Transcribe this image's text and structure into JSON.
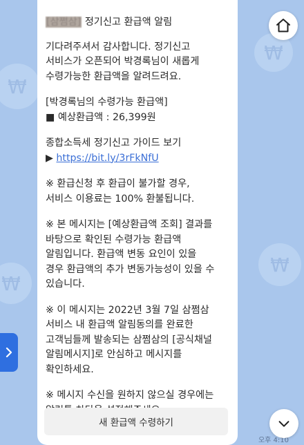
{
  "message": {
    "title_sender": "[삼쩜삼]",
    "title_text": " 정기신고 환급액 알림",
    "greeting_lines": [
      "기다려주셔서 감사합니다. 정기신고",
      "서비스가 오픈되어 박경록님이 새롭게",
      "수령가능한 환급액을 알려드려요."
    ],
    "refund_heading": "[박경록님의 수령가능 환급액]",
    "refund_line": "■ 예상환급액 : 26,399원",
    "guide_title": "종합소득세 정기신고 가이드 보기",
    "guide_arrow": "▶ ",
    "guide_link": "https://bit.ly/3rFkNfU",
    "notice1_lines": [
      "※ 환급신청 후 환급이 불가할 경우,",
      "서비스 이용료는 100% 환불됩니다."
    ],
    "notice2_lines": [
      "※ 본 메시지는 [예상환급액 조회] 결과를",
      "바탕으로 확인된 수령가능 환급액",
      "알림입니다. 환급액 변동 요인이 있을",
      "경우 환급액의 추가 변동가능성이 있을 수",
      "있습니다."
    ],
    "notice3_lines": [
      "※ 이 메시지는 2022년 3월 7일 삼쩜삼",
      "서비스 내 환급액 알림동의를 완료한",
      "고객님들께 발송되는 삼쩜삼의 [공식채널",
      "알림메시지]로 안심하고 메시지를",
      "확인하세요."
    ],
    "notice4_lines": [
      "※ 메시지 수신을 원하지 않으실 경우에는",
      "알림톡 차단을 설정해주세요."
    ],
    "button_label": "새 환급액 수령하기",
    "timestamp": "오후 4:10"
  },
  "controls": {
    "home_icon": "home-icon",
    "scroll_down_icon": "chevron-down-icon",
    "side_tab_icon": "chevron-right-icon"
  },
  "colors": {
    "background": "#a9c6ec",
    "link": "#3b6fd6",
    "side_tab": "#2f6fe0"
  }
}
